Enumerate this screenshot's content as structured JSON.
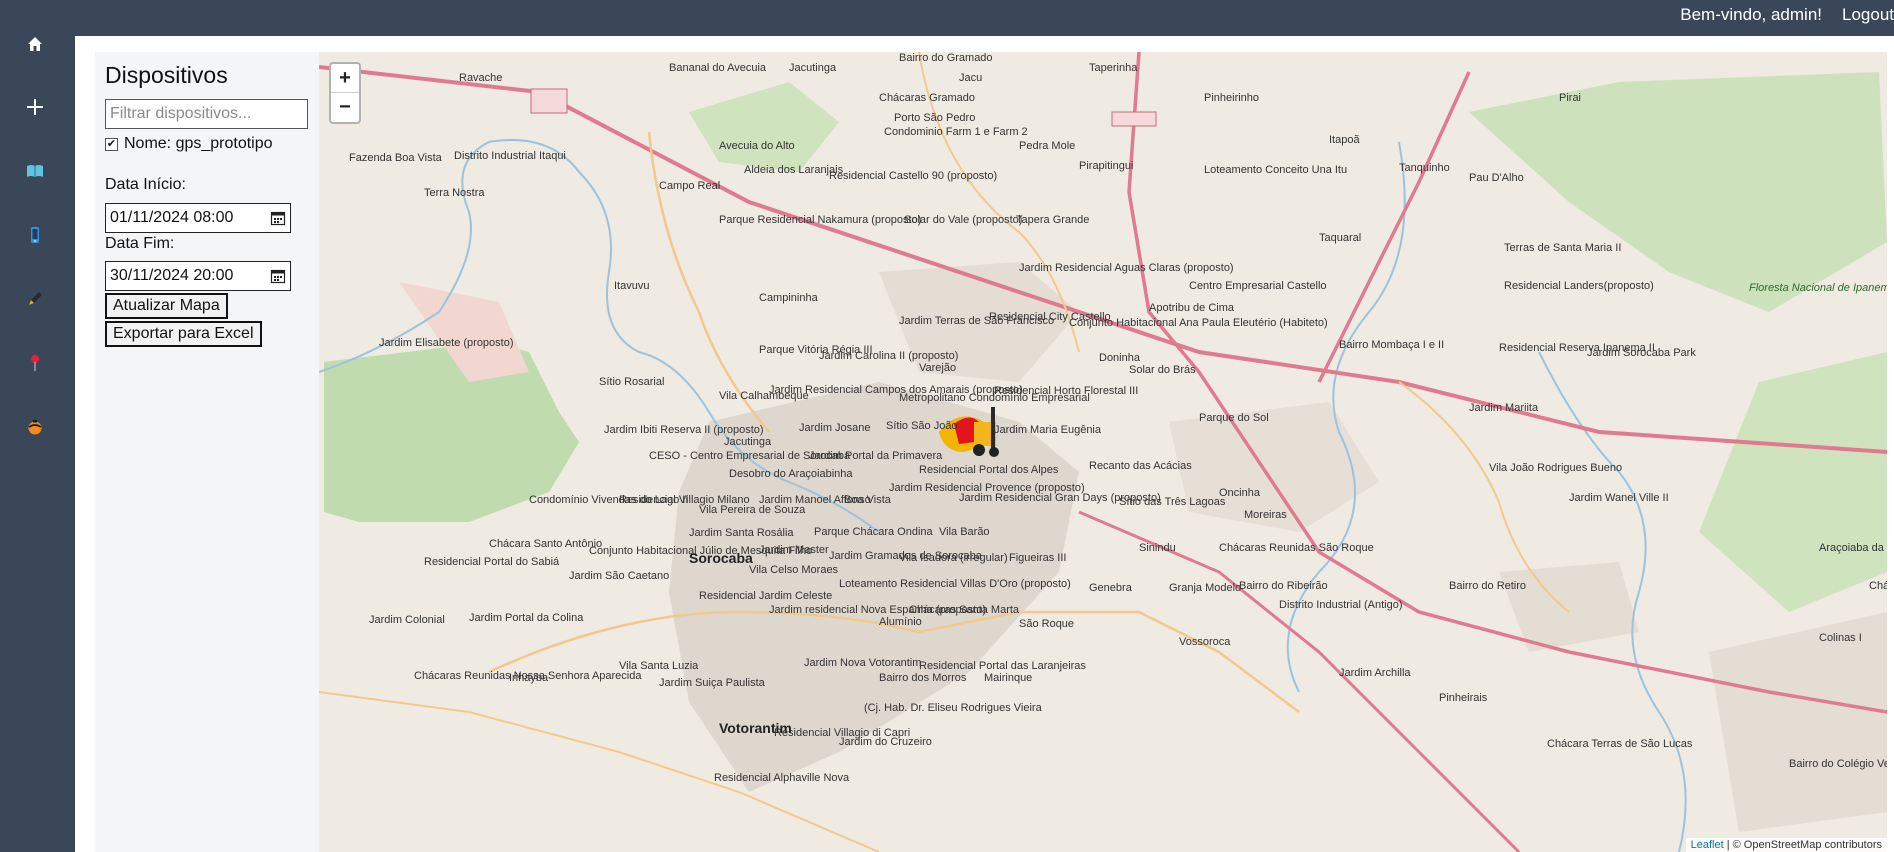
{
  "header": {
    "welcome": "Bem-vindo, admin!",
    "logout": "Logout"
  },
  "sidebar": {
    "items": [
      {
        "icon": "home-icon"
      },
      {
        "icon": "plus-icon"
      },
      {
        "icon": "book-icon"
      },
      {
        "icon": "phone-icon"
      },
      {
        "icon": "pen-icon"
      },
      {
        "icon": "pin-icon"
      },
      {
        "icon": "ball-icon"
      }
    ]
  },
  "panel": {
    "title": "Dispositivos",
    "filter_placeholder": "Filtrar dispositivos...",
    "device_label": "Nome: gps_prototipo",
    "device_checked": true,
    "start_label": "Data Início:",
    "start_value": "01/11/2024 08:00",
    "end_label": "Data Fim:",
    "end_value": "30/11/2024 20:00",
    "update_button": "Atualizar Mapa",
    "export_button": "Exportar para Excel"
  },
  "map": {
    "zoom_in": "+",
    "zoom_out": "−",
    "attribution_leaflet": "Leaflet",
    "attribution_rest": " | © OpenStreetMap contributors",
    "places": [
      "Ravache",
      "Bananal do Avecuia",
      "Jacutinga",
      "Bairro do Gramado",
      "Jacu",
      "Taperinha",
      "Chácaras Gramado",
      "Porto São Pedro",
      "Condominio Farm 1 e Farm 2",
      "Pinheirinho",
      "Pirai",
      "Fazenda Boa Vista",
      "Distrito Industrial Itaqui",
      "Avecuia do Alto",
      "Aldeia dos Laranjais",
      "Residencial Castello 90 (proposto)",
      "Pedra Mole",
      "Pirapitingui",
      "Loteamento Conceito Una Itu",
      "Itapoã",
      "Tanquinho",
      "Pau D'Alho",
      "Campo Real",
      "Terra Nostra",
      "Parque Residencial Nakamura (proposto)",
      "Solar do Vale (proposto)",
      "Tapera Grande",
      "Jardim Residencial Aguas Claras (proposto)",
      "Taquaral",
      "Terras de Santa Maria II",
      "Residencial Landers(proposto)",
      "Itavuvu",
      "Campininha",
      "Centro Empresarial Castello",
      "Apotribu de Cima",
      "Floresta Nacional de Ipanema",
      "Jardim Elisabete (proposto)",
      "Jardim Terras de São Francisco",
      "Residencial City Castello",
      "Conjunto Habitacional Ana Paula Eleutério (Habiteto)",
      "Parque Vitória Régia III",
      "Jardim Carolina II (proposto)",
      "Varejão",
      "Doninha",
      "Bairro Mombaça I e II",
      "Residencial Reserva Ipanema II",
      "Jardim Sorocaba Park",
      "Sítio Rosarial",
      "Jardim Residencial Campos dos Amarais (proposto)",
      "Solar do Brás",
      "Residencial Horto Florestal III",
      "Vila Calhambeque",
      "Metropolitano Condomínio Empresarial",
      "Sítio São João",
      "Parque do Sol",
      "Jardim Mariita",
      "Jardim Ibiti Reserva II (proposto)",
      "Jardim Josane",
      "Jardim Maria Eugênia",
      "Jacutinga",
      "CESO - Centro Empresarial de Sorocaba",
      "Jardim Portal da Primavera",
      "Residencial Portal dos Alpes",
      "Recanto das Acácias",
      "Vila João Rodrigues Bueno",
      "Desobro do Araçoiabinha",
      "Condomínio Vivendas do Lago II",
      "Residencial Villagio Milano",
      "Vila Pereira de Souza",
      "Jardim Manoel Affonso",
      "Boa Vista",
      "Jardim Residencial Provence (proposto)",
      "Jardim Residencial Gran Days (proposto)",
      "Sítio das Três Lagoas",
      "Oncinha",
      "Moreiras",
      "Jardim Wanel Ville II",
      "Jardim Santa Rosália",
      "Parque Chácara Ondina",
      "Vila Barão",
      "Jardim Master",
      "Chácara Santo Antônio",
      "Conjunto Habitacional Júlio de Mesquita Filho",
      "Sorocaba",
      "Jardim Gramados de Sorocaba",
      "Vila Isadora (irregular)",
      "Figueiras III",
      "Sinindu",
      "Chácaras Reunidas São Roque",
      "Araçoiaba da Serra",
      "Residencial Portal do Sabiá",
      "Jardim São Caetano",
      "Vila Celso Moraes",
      "Loteamento Residencial Villas D'Oro (proposto)",
      "Genebra",
      "Granja Modelo",
      "Bairro do Ribeirão",
      "Bairro do Retiro",
      "Chácara Primavera",
      "Jardim Colonial",
      "Jardim Portal da Colina",
      "Residencial Jardim Celeste",
      "Jardim residencial Nova Espanha (proposto)",
      "Alumínio",
      "Chácaras Santa Marta",
      "São Roque",
      "Distrito Industrial (Antigo)",
      "Colinas I",
      "Chácaras Reunidas Nossa Senhora Aparecida",
      "Inhayba",
      "Vila Santa Luzia",
      "Residencial Portal das Laranjeiras",
      "Vossoroca",
      "Jardim Archilla",
      "Jardim Nova Votorantim",
      "Bairro dos Morros",
      "Mairinque",
      "Jardim Suiça Paulista",
      "Pinheirais",
      "Votorantim",
      "Residencial Villagio di Capri",
      "(Cj. Hab. Dr. Eliseu Rodrigues Vieira",
      "Jardim do Cruzeiro",
      "Bairro do Colégio Velho",
      "Chácara Terras de São Lucas",
      "Residencial Alphaville Nova"
    ]
  },
  "colors": {
    "sidebar_bg": "#3a4758",
    "panel_bg": "#f4f5f7",
    "map_bg": "#efeae2",
    "main_road": "#e07a8f",
    "secondary_road": "#f3c98b",
    "forest": "#b7d8a4",
    "urban": "#ddd7cd"
  }
}
